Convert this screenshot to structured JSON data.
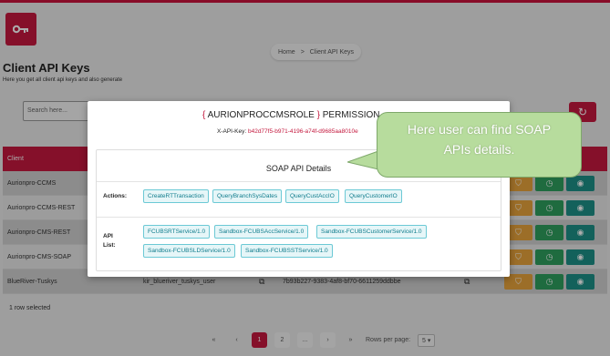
{
  "header": {
    "breadcrumb_home": "Home",
    "breadcrumb_sep": ">",
    "breadcrumb_current": "Client API Keys"
  },
  "page": {
    "title": "Client API Keys",
    "subtitle": "Here you get all client api keys and also generate"
  },
  "search": {
    "placeholder": "Search here..."
  },
  "table": {
    "header": "Client",
    "rows": [
      {
        "client": "Aurionpro-CCMS",
        "user": "",
        "key": ""
      },
      {
        "client": "Aurionpro-CCMS-REST",
        "user": "",
        "key": ""
      },
      {
        "client": "Aurionpro-CMS-REST",
        "user": "",
        "key": ""
      },
      {
        "client": "Aurionpro-CMS-SOAP",
        "user": "",
        "key": ""
      },
      {
        "client": "BlueRiver-Tuskys",
        "user": "kir_blueriver_tuskys_user",
        "key": "7b93b227-9383-4af8-bf70-6611259ddbbe"
      }
    ],
    "selected_info": "1 row selected"
  },
  "pagination": {
    "first": "«",
    "prev": "‹",
    "page1": "1",
    "page2": "2",
    "ellipsis": "...",
    "next": "›",
    "last": "»",
    "rows_per_page_label": "Rows per page:",
    "rows_per_page": "5"
  },
  "modal": {
    "brace_open": "{",
    "role": "AURIONPROCCMSROLE",
    "brace_close": "}",
    "title_suffix": "PERMISSION",
    "key_label": "X-API-Key:",
    "key_value": "b42d77f5-b971-4196-a74f-d9685aa8010e",
    "section_title": "SOAP API Details",
    "actions_label": "Actions:",
    "actions": [
      "CreateRTTransaction",
      "QueryBranchSysDates",
      "QueryCustAccIO",
      "QueryCustomerIO"
    ],
    "api_list_label_1": "API",
    "api_list_label_2": "List:",
    "apis": [
      "FCUBSRTService/1.0",
      "Sandbox-FCUBSAccService/1.0",
      "Sandbox-FCUBSCustomerService/1.0",
      "Sandbox-FCUBSLDService/1.0",
      "Sandbox-FCUBSSTService/1.0"
    ]
  },
  "callout": {
    "line1": "Here user can find SOAP",
    "line2": "APIs details."
  },
  "colors": {
    "brand": "#c4193e",
    "chip_text": "#0f7c8c",
    "callout_bg": "#b7dc9d"
  },
  "icons": {
    "logo": "key-icon",
    "refresh": "refresh-icon",
    "copy": "copy-icon",
    "shield": "shield-icon",
    "history": "history-icon",
    "view": "eye-icon"
  }
}
